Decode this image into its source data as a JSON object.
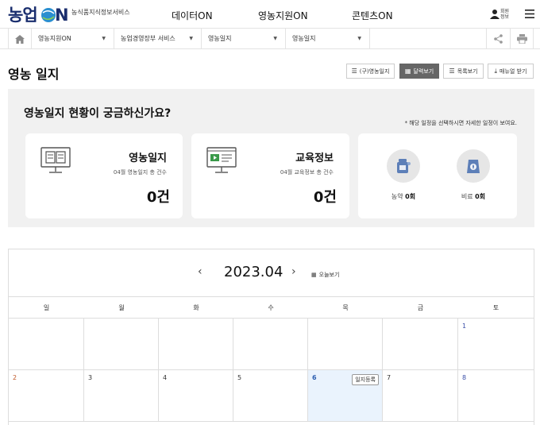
{
  "header": {
    "logo_main": "농업ON",
    "logo_tagline": "농식품지식정보서비스",
    "nav": [
      "데이터ON",
      "영농지원ON",
      "콘텐츠ON"
    ],
    "user_label": "회원 정보"
  },
  "breadcrumb": {
    "items": [
      "영농지원ON",
      "농업경영장부 서비스",
      "영농일지",
      "영농일지"
    ]
  },
  "page": {
    "title": "영농 일지",
    "buttons": [
      {
        "label": "(구)영농일지",
        "icon": "list-icon",
        "active": false
      },
      {
        "label": "달력보기",
        "icon": "calendar-icon",
        "active": true
      },
      {
        "label": "목록보기",
        "icon": "list-icon",
        "active": false
      },
      {
        "label": "매뉴얼 받기",
        "icon": "download-icon",
        "active": false
      }
    ]
  },
  "summary": {
    "question": "영농일지 현황이 궁금하신가요?",
    "note": "* 해당 일정을 선택하시면 자세한 일정이 보여요.",
    "cards": [
      {
        "title": "영농일지",
        "desc": "04월 영농일지 총 건수",
        "count": "0건"
      },
      {
        "title": "교육정보",
        "desc": "04월 교육정보 총 건수",
        "count": "0건"
      }
    ],
    "minis": [
      {
        "label": "농약",
        "count": "0회"
      },
      {
        "label": "비료",
        "count": "0회"
      }
    ]
  },
  "calendar": {
    "month": "2023.04",
    "prev": "‹",
    "next": "›",
    "today_label": "오늘보기",
    "weekdays": [
      "일",
      "월",
      "화",
      "수",
      "목",
      "금",
      "토"
    ],
    "week1_sat": "1",
    "week2": [
      "2",
      "3",
      "4",
      "5",
      "6",
      "7",
      "8"
    ],
    "register_label": "일지등록"
  },
  "colors": {
    "brand": "#1a2e6e",
    "active_button": "#666666",
    "today_bg": "#eaf3fd",
    "sunday": "#c05a2a",
    "saturday": "#3a4fa8"
  }
}
